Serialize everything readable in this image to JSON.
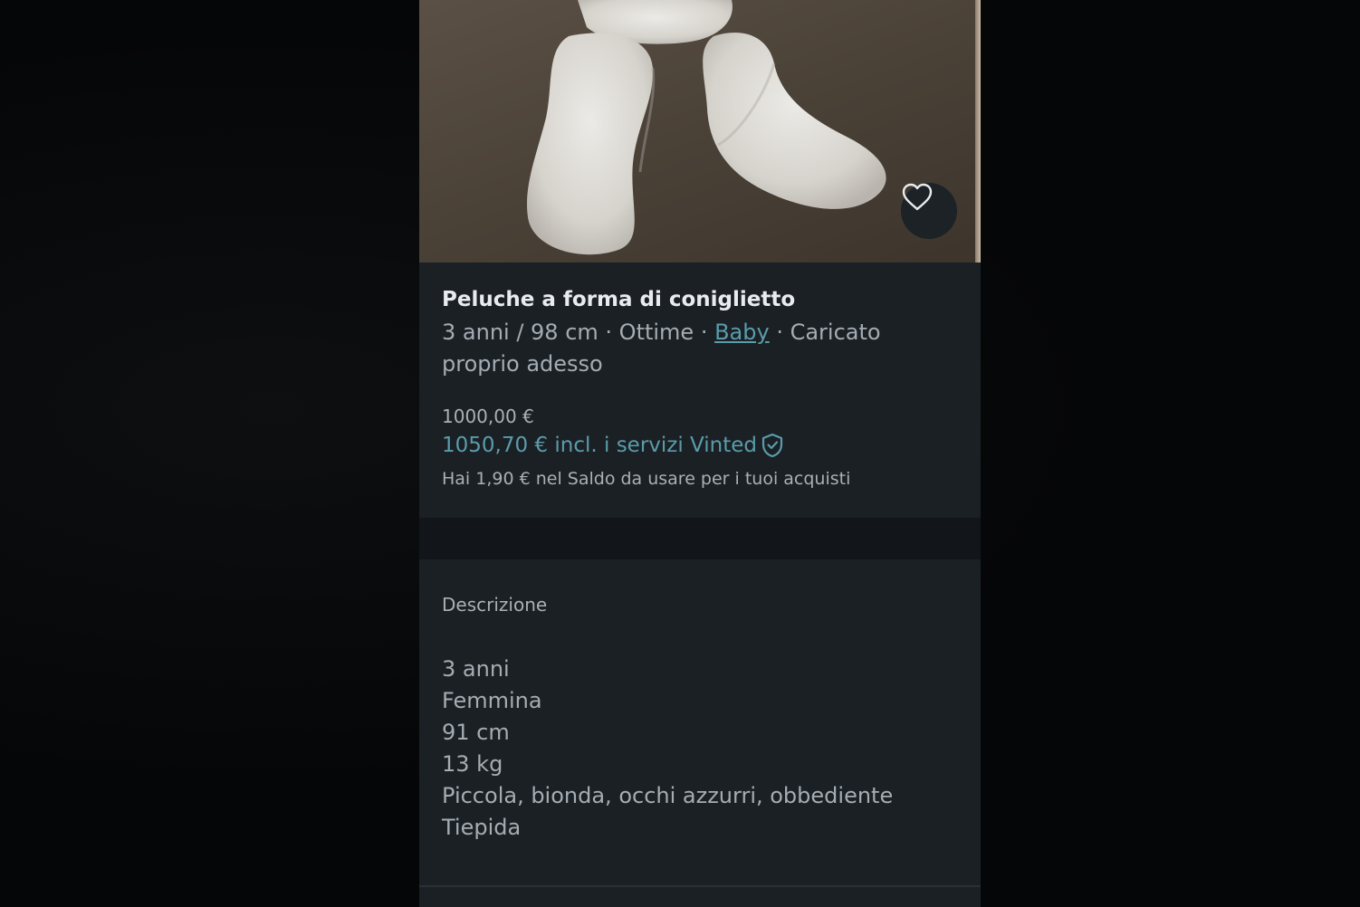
{
  "listing": {
    "title": "Peluche a forma di coniglietto",
    "size": "3 anni / 98 cm",
    "sep1": " · ",
    "condition": "Ottime",
    "sep2": " · ",
    "category_link": "Baby",
    "sep3": " · ",
    "uploaded": "Caricato proprio adesso",
    "price": "1000,00 €",
    "price_with_fees": "1050,70 € incl. i servizi Vinted",
    "balance_note": "Hai 1,90 € nel Saldo da usare per i tuoi acquisti"
  },
  "description": {
    "heading": "Descrizione",
    "lines": [
      "3 anni",
      "Femmina",
      "91 cm",
      "13 kg",
      "Piccola, bionda, occhi azzurri, obbediente",
      "Tiepida"
    ]
  },
  "icons": {
    "favorite": "heart-icon",
    "buyer_protection": "shield-check-icon"
  },
  "colors": {
    "accent": "#5a9cab",
    "panel": "#1b2024",
    "background": "#050607"
  }
}
